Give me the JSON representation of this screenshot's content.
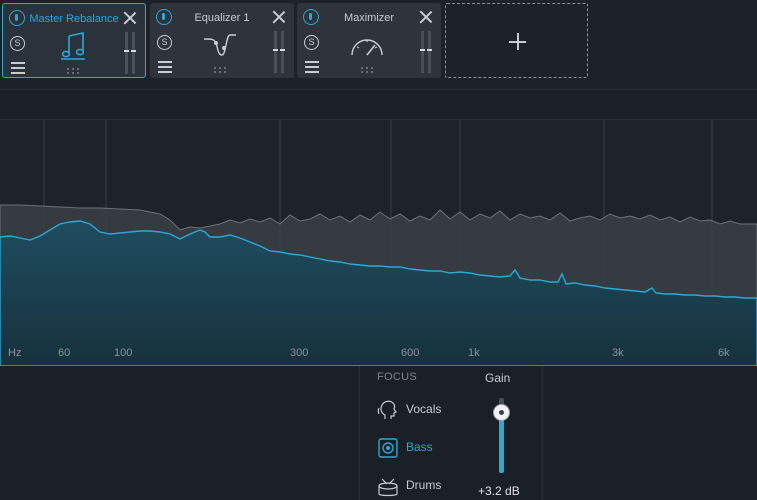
{
  "modules": [
    {
      "title": "Master Rebalance",
      "active": true,
      "glyph": "music-note-icon"
    },
    {
      "title": "Equalizer 1",
      "active": false,
      "glyph": "eq-curve-icon"
    },
    {
      "title": "Maximizer",
      "active": false,
      "glyph": "gauge-icon"
    }
  ],
  "module_controls": {
    "solo_label": "S"
  },
  "spectrum": {
    "unit_label": "Hz",
    "freq_labels": [
      "60",
      "100",
      "300",
      "600",
      "1k",
      "3k",
      "6k"
    ]
  },
  "focus": {
    "heading": "FOCUS",
    "items": [
      {
        "label": "Vocals",
        "icon": "face-profile-icon"
      },
      {
        "label": "Bass",
        "icon": "speaker-icon",
        "selected": true
      },
      {
        "label": "Drums",
        "icon": "drum-icon"
      }
    ]
  },
  "gain": {
    "label": "Gain",
    "value_text": "+3.2 dB",
    "level_fraction": 0.82
  },
  "colors": {
    "accent": "#2aa9d6",
    "background": "#1b1f26",
    "module_bg": "#2f343c",
    "grid": "#3a3f47"
  }
}
